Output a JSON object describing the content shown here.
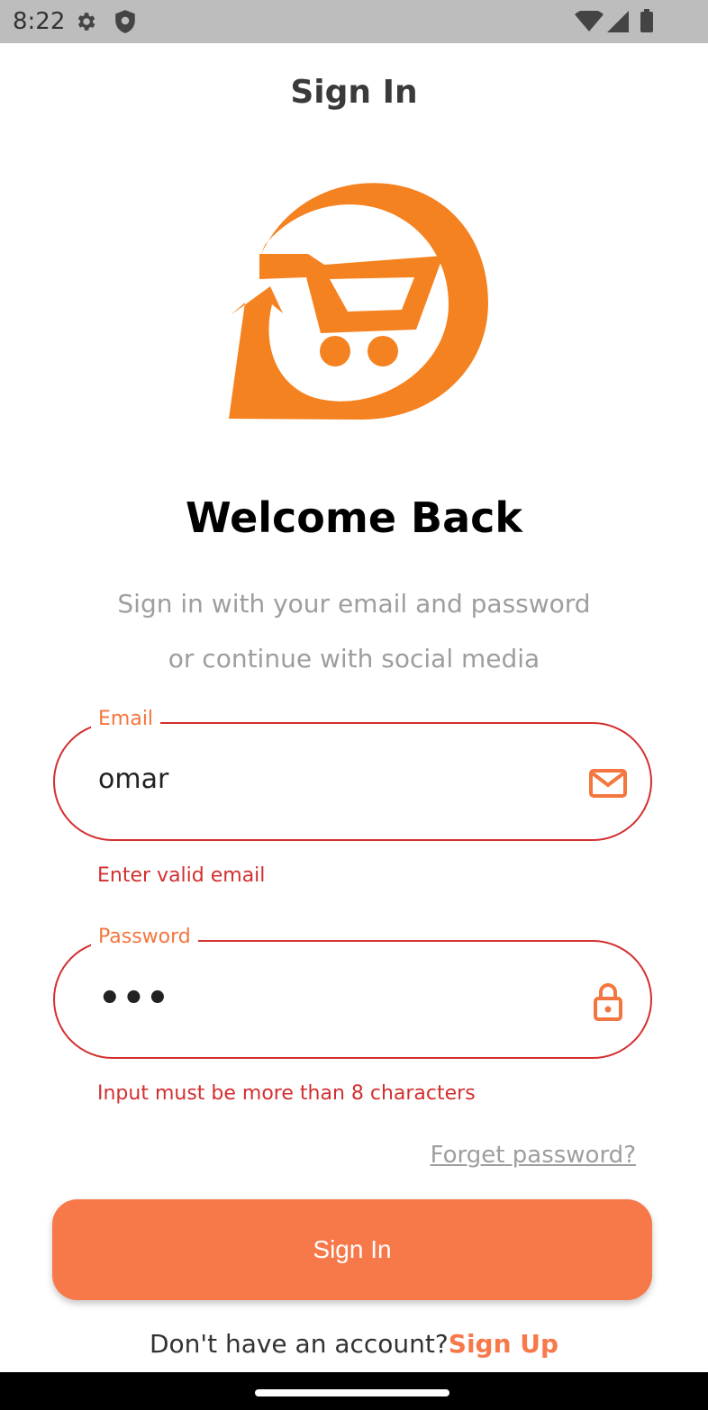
{
  "status_bar": {
    "time": "8:22",
    "icons": [
      "gear-icon",
      "shield-icon",
      "wifi-icon",
      "signal-icon",
      "battery-icon"
    ]
  },
  "header": {
    "title": "Sign In"
  },
  "welcome": {
    "title": "Welcome Back",
    "subtitle_line1": "Sign in with your email and password",
    "subtitle_line2": "or continue with social media"
  },
  "form": {
    "email": {
      "label": "Email",
      "value": "omar",
      "error": "Enter valid email",
      "icon": "mail-icon"
    },
    "password": {
      "label": "Password",
      "value": "•••",
      "error": "Input must be more than 8 characters",
      "icon": "lock-icon"
    },
    "forgot_label": "Forget password?",
    "submit_label": "Sign In"
  },
  "footer": {
    "prompt": "Don't have an account?",
    "link": "Sign Up"
  },
  "colors": {
    "accent": "#f7794a",
    "logo": "#f58220",
    "error": "#d32f2f",
    "muted": "#9e9e9e"
  }
}
